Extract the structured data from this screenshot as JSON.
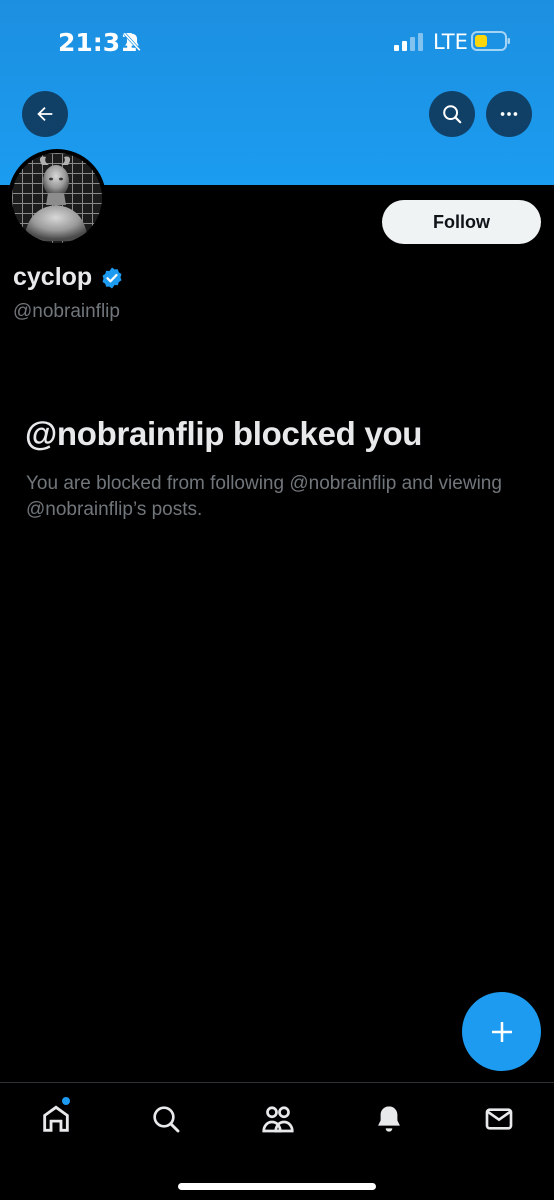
{
  "status_bar": {
    "time": "21:31",
    "network": "LTE",
    "icons": [
      "bell-slash-icon",
      "signal-icon",
      "battery-icon"
    ]
  },
  "header": {
    "banner_color": "#1d9bf0",
    "back_icon": "arrow-left-icon",
    "search_icon": "search-icon",
    "more_icon": "more-horizontal-icon"
  },
  "profile": {
    "display_name": "cyclop",
    "verified": true,
    "handle": "@nobrainflip",
    "follow_label": "Follow"
  },
  "blocked_notice": {
    "title": "@nobrainflip blocked you",
    "description": "You are blocked from following @nobrainflip and viewing @nobrainflip’s posts."
  },
  "fab": {
    "icon": "plus-icon",
    "color": "#1d9bf0"
  },
  "bottom_nav": {
    "items": [
      "home-icon",
      "search-icon",
      "communities-icon",
      "notifications-icon",
      "messages-icon"
    ],
    "active": "home-icon",
    "unread_indicator": true
  },
  "colors": {
    "accent": "#1d9bf0",
    "background": "#000000",
    "text_primary": "#e7e9ea",
    "text_secondary": "#71767b"
  }
}
